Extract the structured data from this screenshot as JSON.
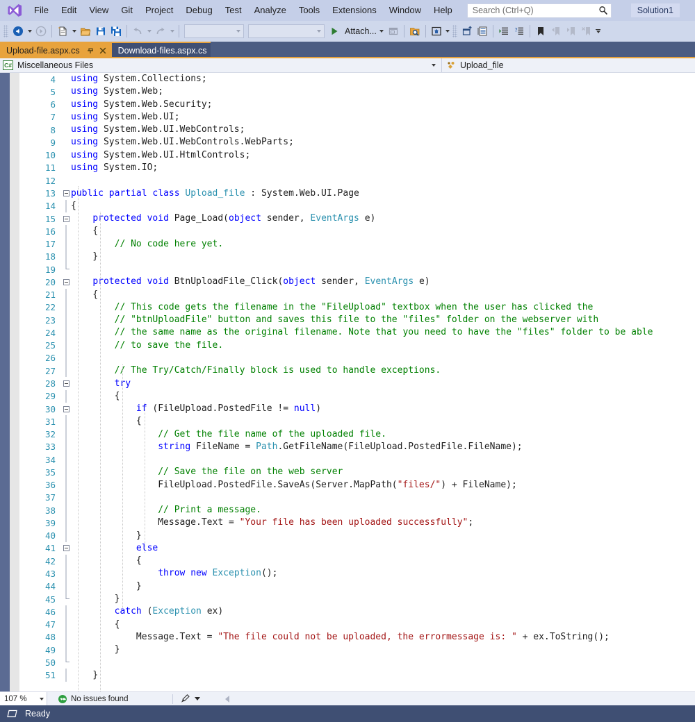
{
  "menu": {
    "logo_icon": "visual-studio-logo",
    "items": [
      "File",
      "Edit",
      "View",
      "Git",
      "Project",
      "Debug",
      "Test",
      "Analyze",
      "Tools",
      "Extensions",
      "Window",
      "Help"
    ],
    "search_placeholder": "Search (Ctrl+Q)",
    "search_icon": "search-icon",
    "solution_name": "Solution1"
  },
  "toolbar": {
    "navigate_back_icon": "navigate-back-icon",
    "navigate_forward_icon": "navigate-forward-icon",
    "new_item_icon": "new-item-icon",
    "open_file_icon": "open-file-icon",
    "save_icon": "save-icon",
    "save_all_icon": "save-all-icon",
    "undo_icon": "undo-icon",
    "redo_icon": "redo-icon",
    "config_combo_value": "",
    "platform_combo_value": "",
    "attach_label": "Attach...",
    "attach_play_icon": "start-debug-icon",
    "window_icon": "window-icon",
    "find_in_files_icon": "find-in-files-icon",
    "browser_icon": "web-browser-icon",
    "solution_explorer_icon": "solution-explorer-icon",
    "properties_icon": "properties-window-icon",
    "indent_icon": "indent-icon",
    "comment_icon": "comment-icon",
    "bookmark_icon": "bookmark-icon",
    "prev_bookmark_icon": "previous-bookmark-icon",
    "next_bookmark_icon": "next-bookmark-icon",
    "clear_bookmarks_icon": "clear-bookmarks-icon",
    "overflow_icon": "toolbar-overflow-icon"
  },
  "tabs": [
    {
      "label": "Upload-file.aspx.cs",
      "active": true,
      "pin_icon": "pin-icon",
      "close_icon": "close-icon"
    },
    {
      "label": "Download-files.aspx.cs",
      "active": false
    }
  ],
  "navbar": {
    "project_icon": "csharp-file-icon",
    "project_badge": "C#",
    "project_label": "Miscellaneous Files",
    "dropdown_icon": "chevron-down-icon",
    "member_icon": "class-member-icon",
    "member_label": "Upload_file"
  },
  "editor": {
    "first_line_number": 4,
    "lines": [
      {
        "n": 4,
        "fold": "none",
        "tokens": [
          {
            "t": "using",
            "c": "k"
          },
          {
            "t": " System.Collections;",
            "c": "p"
          }
        ]
      },
      {
        "n": 5,
        "fold": "none",
        "tokens": [
          {
            "t": "using",
            "c": "k"
          },
          {
            "t": " System.Web;",
            "c": "p"
          }
        ]
      },
      {
        "n": 6,
        "fold": "none",
        "tokens": [
          {
            "t": "using",
            "c": "k"
          },
          {
            "t": " System.Web.Security;",
            "c": "p"
          }
        ]
      },
      {
        "n": 7,
        "fold": "none",
        "tokens": [
          {
            "t": "using",
            "c": "k"
          },
          {
            "t": " System.Web.UI;",
            "c": "p"
          }
        ]
      },
      {
        "n": 8,
        "fold": "none",
        "tokens": [
          {
            "t": "using",
            "c": "k"
          },
          {
            "t": " System.Web.UI.WebControls;",
            "c": "p"
          }
        ]
      },
      {
        "n": 9,
        "fold": "none",
        "tokens": [
          {
            "t": "using",
            "c": "k"
          },
          {
            "t": " System.Web.UI.WebControls.WebParts;",
            "c": "p"
          }
        ]
      },
      {
        "n": 10,
        "fold": "none",
        "tokens": [
          {
            "t": "using",
            "c": "k"
          },
          {
            "t": " System.Web.UI.HtmlControls;",
            "c": "p"
          }
        ]
      },
      {
        "n": 11,
        "fold": "none",
        "tokens": [
          {
            "t": "using",
            "c": "k"
          },
          {
            "t": " System.IO;",
            "c": "p"
          }
        ]
      },
      {
        "n": 12,
        "fold": "none",
        "tokens": []
      },
      {
        "n": 13,
        "fold": "open",
        "tokens": [
          {
            "t": "public",
            "c": "k"
          },
          {
            "t": " ",
            "c": "p"
          },
          {
            "t": "partial",
            "c": "k"
          },
          {
            "t": " ",
            "c": "p"
          },
          {
            "t": "class",
            "c": "k"
          },
          {
            "t": " ",
            "c": "p"
          },
          {
            "t": "Upload_file",
            "c": "t"
          },
          {
            "t": " : System.Web.UI.Page",
            "c": "p"
          }
        ]
      },
      {
        "n": 14,
        "fold": "line",
        "tokens": [
          {
            "t": "{",
            "c": "p"
          }
        ]
      },
      {
        "n": 15,
        "fold": "open",
        "tokens": [
          {
            "t": "    ",
            "c": "p"
          },
          {
            "t": "protected",
            "c": "k"
          },
          {
            "t": " ",
            "c": "p"
          },
          {
            "t": "void",
            "c": "k"
          },
          {
            "t": " Page_Load(",
            "c": "p"
          },
          {
            "t": "object",
            "c": "k"
          },
          {
            "t": " sender, ",
            "c": "p"
          },
          {
            "t": "EventArgs",
            "c": "t"
          },
          {
            "t": " e)",
            "c": "p"
          }
        ]
      },
      {
        "n": 16,
        "fold": "line",
        "tokens": [
          {
            "t": "    {",
            "c": "p"
          }
        ]
      },
      {
        "n": 17,
        "fold": "line",
        "tokens": [
          {
            "t": "        ",
            "c": "p"
          },
          {
            "t": "// No code here yet.",
            "c": "c"
          }
        ]
      },
      {
        "n": 18,
        "fold": "line",
        "tokens": [
          {
            "t": "    }",
            "c": "p"
          }
        ]
      },
      {
        "n": 19,
        "fold": "end",
        "tokens": []
      },
      {
        "n": 20,
        "fold": "open",
        "tokens": [
          {
            "t": "    ",
            "c": "p"
          },
          {
            "t": "protected",
            "c": "k"
          },
          {
            "t": " ",
            "c": "p"
          },
          {
            "t": "void",
            "c": "k"
          },
          {
            "t": " BtnUploadFile_Click(",
            "c": "p"
          },
          {
            "t": "object",
            "c": "k"
          },
          {
            "t": " sender, ",
            "c": "p"
          },
          {
            "t": "EventArgs",
            "c": "t"
          },
          {
            "t": " e)",
            "c": "p"
          }
        ]
      },
      {
        "n": 21,
        "fold": "line",
        "tokens": [
          {
            "t": "    {",
            "c": "p"
          }
        ]
      },
      {
        "n": 22,
        "fold": "line",
        "tokens": [
          {
            "t": "        ",
            "c": "p"
          },
          {
            "t": "// This code gets the filename in the \"FileUpload\" textbox when the user has clicked the",
            "c": "c"
          }
        ]
      },
      {
        "n": 23,
        "fold": "line",
        "tokens": [
          {
            "t": "        ",
            "c": "p"
          },
          {
            "t": "// \"btnUploadFile\" button and saves this file to the \"files\" folder on the webserver with",
            "c": "c"
          }
        ]
      },
      {
        "n": 24,
        "fold": "line",
        "tokens": [
          {
            "t": "        ",
            "c": "p"
          },
          {
            "t": "// the same name as the original filename. Note that you need to have the \"files\" folder to be able",
            "c": "c"
          }
        ]
      },
      {
        "n": 25,
        "fold": "line",
        "tokens": [
          {
            "t": "        ",
            "c": "p"
          },
          {
            "t": "// to save the file.",
            "c": "c"
          }
        ]
      },
      {
        "n": 26,
        "fold": "line",
        "tokens": []
      },
      {
        "n": 27,
        "fold": "line",
        "tokens": [
          {
            "t": "        ",
            "c": "p"
          },
          {
            "t": "// The Try/Catch/Finally block is used to handle exceptions.",
            "c": "c"
          }
        ]
      },
      {
        "n": 28,
        "fold": "open",
        "tokens": [
          {
            "t": "        ",
            "c": "p"
          },
          {
            "t": "try",
            "c": "k"
          }
        ]
      },
      {
        "n": 29,
        "fold": "line",
        "tokens": [
          {
            "t": "        {",
            "c": "p"
          }
        ]
      },
      {
        "n": 30,
        "fold": "open",
        "tokens": [
          {
            "t": "            ",
            "c": "p"
          },
          {
            "t": "if",
            "c": "k"
          },
          {
            "t": " (FileUpload.PostedFile != ",
            "c": "p"
          },
          {
            "t": "null",
            "c": "k"
          },
          {
            "t": ")",
            "c": "p"
          }
        ]
      },
      {
        "n": 31,
        "fold": "line",
        "tokens": [
          {
            "t": "            {",
            "c": "p"
          }
        ]
      },
      {
        "n": 32,
        "fold": "line",
        "tokens": [
          {
            "t": "                ",
            "c": "p"
          },
          {
            "t": "// Get the file name of the uploaded file.",
            "c": "c"
          }
        ]
      },
      {
        "n": 33,
        "fold": "line",
        "tokens": [
          {
            "t": "                ",
            "c": "p"
          },
          {
            "t": "string",
            "c": "k"
          },
          {
            "t": " FileName = ",
            "c": "p"
          },
          {
            "t": "Path",
            "c": "t"
          },
          {
            "t": ".GetFileName(FileUpload.PostedFile.FileName);",
            "c": "p"
          }
        ]
      },
      {
        "n": 34,
        "fold": "line",
        "tokens": []
      },
      {
        "n": 35,
        "fold": "line",
        "tokens": [
          {
            "t": "                ",
            "c": "p"
          },
          {
            "t": "// Save the file on the web server",
            "c": "c"
          }
        ]
      },
      {
        "n": 36,
        "fold": "line",
        "tokens": [
          {
            "t": "                FileUpload.PostedFile.SaveAs(Server.MapPath(",
            "c": "p"
          },
          {
            "t": "\"files/\"",
            "c": "s"
          },
          {
            "t": ") + FileName);",
            "c": "p"
          }
        ]
      },
      {
        "n": 37,
        "fold": "line",
        "tokens": []
      },
      {
        "n": 38,
        "fold": "line",
        "tokens": [
          {
            "t": "                ",
            "c": "p"
          },
          {
            "t": "// Print a message.",
            "c": "c"
          }
        ]
      },
      {
        "n": 39,
        "fold": "line",
        "tokens": [
          {
            "t": "                Message.Text = ",
            "c": "p"
          },
          {
            "t": "\"Your file has been uploaded successfully\"",
            "c": "s"
          },
          {
            "t": ";",
            "c": "p"
          }
        ]
      },
      {
        "n": 40,
        "fold": "line",
        "tokens": [
          {
            "t": "            }",
            "c": "p"
          }
        ]
      },
      {
        "n": 41,
        "fold": "open",
        "tokens": [
          {
            "t": "            ",
            "c": "p"
          },
          {
            "t": "else",
            "c": "k"
          }
        ]
      },
      {
        "n": 42,
        "fold": "line",
        "tokens": [
          {
            "t": "            {",
            "c": "p"
          }
        ]
      },
      {
        "n": 43,
        "fold": "line",
        "tokens": [
          {
            "t": "                ",
            "c": "p"
          },
          {
            "t": "throw",
            "c": "k"
          },
          {
            "t": " ",
            "c": "p"
          },
          {
            "t": "new",
            "c": "k"
          },
          {
            "t": " ",
            "c": "p"
          },
          {
            "t": "Exception",
            "c": "t"
          },
          {
            "t": "();",
            "c": "p"
          }
        ]
      },
      {
        "n": 44,
        "fold": "line",
        "tokens": [
          {
            "t": "            }",
            "c": "p"
          }
        ]
      },
      {
        "n": 45,
        "fold": "end",
        "tokens": [
          {
            "t": "        }",
            "c": "p"
          }
        ]
      },
      {
        "n": 46,
        "fold": "line",
        "tokens": [
          {
            "t": "        ",
            "c": "p"
          },
          {
            "t": "catch",
            "c": "k"
          },
          {
            "t": " (",
            "c": "p"
          },
          {
            "t": "Exception",
            "c": "t"
          },
          {
            "t": " ex)",
            "c": "p"
          }
        ]
      },
      {
        "n": 47,
        "fold": "line",
        "tokens": [
          {
            "t": "        {",
            "c": "p"
          }
        ]
      },
      {
        "n": 48,
        "fold": "line",
        "tokens": [
          {
            "t": "            Message.Text = ",
            "c": "p"
          },
          {
            "t": "\"The file could not be uploaded, the errormessage is: \"",
            "c": "s"
          },
          {
            "t": " + ex.ToString();",
            "c": "p"
          }
        ]
      },
      {
        "n": 49,
        "fold": "line",
        "tokens": [
          {
            "t": "        }",
            "c": "p"
          }
        ]
      },
      {
        "n": 50,
        "fold": "end",
        "tokens": []
      },
      {
        "n": 51,
        "fold": "line",
        "tokens": [
          {
            "t": "    }",
            "c": "p"
          }
        ]
      }
    ]
  },
  "editor_status": {
    "zoom_level": "107 %",
    "issues_icon": "checkmark-ok-icon",
    "issues_text": "No issues found",
    "brush_icon": "code-cleanup-icon",
    "brush_caret_icon": "chevron-down-icon",
    "scroll_left_icon": "scroll-left-icon"
  },
  "statusbar": {
    "ready_icon": "ready-icon",
    "ready_text": "Ready"
  },
  "colors": {
    "menubar_bg": "#c5cfe8",
    "toolbar_bg": "#cfd8ec",
    "tab_active_bg": "#3f4f73",
    "tab_inactive_bg": "#e8a33d",
    "accent_orange": "#e8a33d",
    "statusbar_bg": "#3f4f73",
    "keyword": "#0000ff",
    "type": "#2b91af",
    "string": "#a31515",
    "comment": "#008000",
    "linenumber": "#2b91af"
  }
}
